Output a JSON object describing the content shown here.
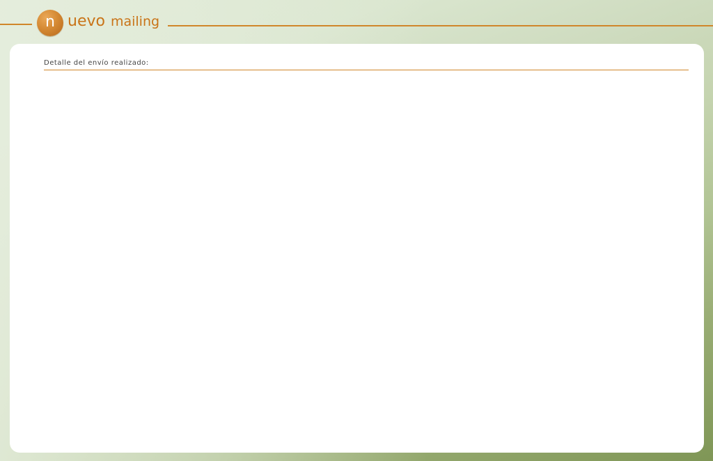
{
  "header": {
    "logo_letter": "n",
    "title_word1": "uevo",
    "title_word2": "mailing"
  },
  "main": {
    "section_title": "Detalle del envío realizado:"
  },
  "colors": {
    "accent": "#d0862a",
    "title_text": "#c97418",
    "panel": "#ffffff"
  }
}
